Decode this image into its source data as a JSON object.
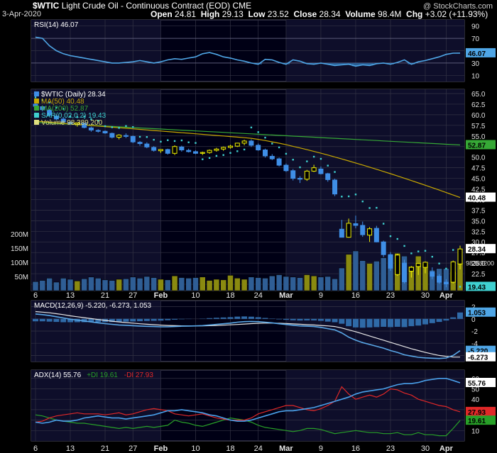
{
  "header": {
    "symbol": "$WTIC",
    "name": "Light Crude Oil - Continuous Contract (EOD)",
    "exchange": "CME",
    "date": "3-Apr-2020",
    "open_label": "Open",
    "open": "24.81",
    "high_label": "High",
    "high": "29.13",
    "low_label": "Low",
    "low": "23.52",
    "close_label": "Close",
    "close": "28.34",
    "volume_label": "Volume",
    "volume": "98.4M",
    "chg_label": "Chg",
    "chg": "+3.02 (+11.93%)",
    "copyright": "@ StockCharts.com"
  },
  "colors": {
    "background": "#000000",
    "panel_bg": "#000015",
    "grid": "#333344",
    "up": "#eeee00",
    "down": "#3f8ee6",
    "rsi": "#4fa6e6",
    "ma50": "#c8a800",
    "ma200": "#36a836",
    "sar": "#3fd0d0",
    "volume_up": "#8a8a10",
    "volume_down": "#2f5e95",
    "macd": "#5aa8e8",
    "signal": "#e8e8e8",
    "adx": "#4aa0ea",
    "plus_di": "#28a028",
    "minus_di": "#e02828"
  },
  "x_ticks": [
    "6",
    "13",
    "21",
    "27",
    "Feb",
    "10",
    "18",
    "24",
    "Mar",
    "9",
    "16",
    "23",
    "30",
    "Apr"
  ],
  "chart_data": [
    {
      "type": "line",
      "panel": "RSI",
      "legend": "RSI(14) 46.07",
      "yticks": [
        "90",
        "70",
        "50",
        "30",
        "10"
      ],
      "ylim": [
        0,
        100
      ],
      "last_label": "46.07",
      "series": [
        {
          "name": "RSI(14)",
          "values": [
            72,
            70,
            58,
            50,
            45,
            42,
            40,
            38,
            36,
            34,
            32,
            30,
            30,
            31,
            32,
            34,
            32,
            30,
            32,
            35,
            37,
            36,
            38,
            40,
            45,
            47,
            44,
            40,
            38,
            35,
            33,
            30,
            28,
            36,
            35,
            31,
            28,
            35,
            33,
            29,
            28,
            30,
            28,
            26,
            27,
            28,
            25,
            27,
            26,
            29,
            30,
            28,
            31,
            35,
            28,
            32,
            34,
            37,
            40,
            44,
            46,
            46.07
          ]
        }
      ]
    },
    {
      "type": "candlestick",
      "panel": "price",
      "legend": [
        "$WTIC (Daily) 28.34",
        "MA(50) 40.48",
        "MA(200) 52.87",
        "SAR(0.02,0.2) 19.43",
        "Volume 98,389,200"
      ],
      "yticks": [
        "65.0",
        "62.5",
        "60.0",
        "57.5",
        "55.0",
        "52.5",
        "50.0",
        "47.5",
        "45.0",
        "42.5",
        "40.0",
        "37.5",
        "35.0",
        "32.5",
        "30.0",
        "27.5",
        "25.0",
        "22.5",
        "20.0"
      ],
      "ylim": [
        18.5,
        66
      ],
      "volume_ticks": [
        "200M",
        "150M",
        "100M",
        "50M"
      ],
      "volume_last_label": "98389200",
      "last_labels": {
        "close": "28.34",
        "ma200": "52.87",
        "ma50": "40.48",
        "sar": "19.43"
      },
      "ohlc": [
        [
          62.5,
          63.1,
          61.8,
          62.0
        ],
        [
          61.9,
          62.2,
          60.8,
          61.2
        ],
        [
          61.1,
          61.4,
          59.6,
          59.9
        ],
        [
          59.7,
          59.9,
          58.7,
          59.0
        ],
        [
          59.0,
          59.4,
          58.0,
          58.3
        ],
        [
          58.2,
          58.6,
          57.6,
          57.9
        ],
        [
          57.8,
          58.2,
          57.2,
          58.1
        ],
        [
          58.0,
          58.1,
          56.8,
          57.0
        ],
        [
          56.9,
          57.2,
          56.0,
          56.4
        ],
        [
          56.3,
          56.6,
          55.8,
          56.1
        ],
        [
          56.1,
          56.3,
          55.5,
          55.7
        ],
        [
          55.6,
          55.8,
          54.4,
          54.7
        ],
        [
          54.7,
          55.4,
          54.2,
          55.2
        ],
        [
          55.1,
          55.6,
          54.5,
          55.0
        ],
        [
          54.9,
          55.1,
          53.3,
          53.6
        ],
        [
          53.5,
          53.8,
          52.7,
          53.2
        ],
        [
          53.1,
          53.5,
          52.1,
          52.4
        ],
        [
          52.3,
          52.6,
          51.3,
          51.6
        ],
        [
          51.5,
          51.9,
          51.0,
          51.8
        ],
        [
          51.8,
          52.0,
          50.6,
          50.9
        ],
        [
          50.9,
          52.8,
          50.5,
          52.5
        ],
        [
          52.4,
          52.7,
          51.3,
          51.7
        ],
        [
          51.6,
          52.0,
          51.1,
          51.3
        ],
        [
          51.3,
          51.6,
          50.7,
          50.9
        ],
        [
          50.9,
          51.3,
          50.5,
          51.1
        ],
        [
          51.1,
          51.8,
          50.8,
          51.6
        ],
        [
          51.6,
          52.2,
          51.3,
          51.9
        ],
        [
          51.9,
          52.5,
          51.5,
          52.3
        ],
        [
          52.3,
          52.9,
          52.0,
          52.6
        ],
        [
          52.6,
          53.4,
          52.4,
          53.3
        ],
        [
          53.3,
          54.1,
          52.8,
          53.8
        ],
        [
          53.8,
          54.2,
          52.4,
          52.8
        ],
        [
          52.8,
          53.2,
          51.5,
          51.7
        ],
        [
          51.7,
          52.0,
          49.9,
          50.3
        ],
        [
          50.2,
          50.7,
          49.3,
          49.6
        ],
        [
          49.6,
          49.9,
          47.8,
          48.1
        ],
        [
          48.1,
          48.5,
          46.5,
          46.8
        ],
        [
          46.8,
          47.2,
          44.5,
          45.0
        ],
        [
          45.0,
          45.5,
          43.9,
          44.8
        ],
        [
          44.8,
          47.0,
          44.4,
          46.7
        ],
        [
          46.7,
          48.2,
          46.5,
          47.5
        ],
        [
          47.2,
          47.8,
          45.9,
          46.1
        ],
        [
          46.1,
          46.3,
          44.2,
          44.7
        ],
        [
          44.6,
          44.9,
          40.8,
          41.3
        ],
        [
          33.0,
          35.2,
          31.5,
          31.1
        ],
        [
          31.1,
          35.5,
          31.0,
          34.4
        ],
        [
          34.3,
          36.2,
          33.2,
          33.9
        ],
        [
          33.9,
          34.8,
          31.2,
          31.7
        ],
        [
          31.6,
          33.5,
          30.0,
          33.1
        ],
        [
          33.2,
          33.8,
          29.9,
          30.0
        ],
        [
          30.0,
          30.3,
          26.4,
          27.0
        ],
        [
          27.0,
          27.6,
          23.2,
          23.8
        ],
        [
          22.3,
          27.2,
          22.0,
          26.9
        ],
        [
          25.0,
          25.8,
          20.2,
          20.6
        ],
        [
          23.1,
          24.3,
          21.6,
          24.0
        ],
        [
          24.2,
          25.0,
          22.2,
          24.9
        ],
        [
          24.0,
          25.4,
          22.6,
          25.2
        ],
        [
          22.9,
          24.0,
          21.2,
          21.9
        ],
        [
          21.9,
          22.4,
          20.1,
          20.5
        ],
        [
          20.5,
          21.2,
          19.3,
          20.1
        ],
        [
          20.5,
          25.6,
          20.2,
          25.3
        ],
        [
          24.81,
          29.13,
          23.52,
          28.34
        ]
      ],
      "volume_m": [
        32,
        36,
        44,
        30,
        44,
        40,
        34,
        42,
        48,
        44,
        38,
        36,
        40,
        42,
        48,
        44,
        50,
        46,
        40,
        38,
        52,
        46,
        44,
        46,
        48,
        36,
        40,
        38,
        54,
        44,
        40,
        48,
        46,
        44,
        52,
        56,
        50,
        48,
        46,
        56,
        52,
        48,
        50,
        42,
        80,
        128,
        140,
        106,
        96,
        104,
        116,
        126,
        132,
        122,
        86,
        122,
        96,
        72,
        78,
        78,
        68,
        98.4
      ]
    },
    {
      "type": "line",
      "panel": "MACD",
      "legend": "MACD(12,26,9) -5.220, -6.273, 1.053",
      "yticks": [
        "2",
        "0",
        "-2",
        "-4",
        "-6"
      ],
      "ylim": [
        -7,
        3
      ],
      "last_labels": {
        "histogram": "1.053",
        "macd": "-5.220",
        "signal": "-6.273"
      },
      "series": [
        {
          "name": "MACD",
          "values": [
            0.8,
            0.7,
            0.55,
            0.35,
            0.15,
            -0.05,
            -0.2,
            -0.35,
            -0.5,
            -0.65,
            -0.78,
            -0.9,
            -1.0,
            -1.05,
            -1.12,
            -1.18,
            -1.22,
            -1.26,
            -1.3,
            -1.3,
            -1.25,
            -1.2,
            -1.18,
            -1.15,
            -1.1,
            -1.0,
            -0.9,
            -0.8,
            -0.7,
            -0.55,
            -0.45,
            -0.42,
            -0.45,
            -0.55,
            -0.65,
            -0.8,
            -0.92,
            -1.05,
            -1.15,
            -1.2,
            -1.25,
            -1.4,
            -1.6,
            -1.8,
            -2.3,
            -3.0,
            -3.5,
            -3.9,
            -4.2,
            -4.5,
            -4.8,
            -5.2,
            -5.5,
            -5.9,
            -6.1,
            -6.3,
            -6.4,
            -6.45,
            -6.5,
            -6.42,
            -6.0,
            -5.22
          ]
        },
        {
          "name": "Signal",
          "values": [
            1.2,
            1.1,
            1.0,
            0.85,
            0.7,
            0.5,
            0.35,
            0.2,
            0.05,
            -0.1,
            -0.25,
            -0.38,
            -0.5,
            -0.6,
            -0.7,
            -0.8,
            -0.88,
            -0.95,
            -1.02,
            -1.08,
            -1.12,
            -1.14,
            -1.15,
            -1.15,
            -1.14,
            -1.12,
            -1.08,
            -1.03,
            -0.98,
            -0.92,
            -0.85,
            -0.78,
            -0.72,
            -0.7,
            -0.7,
            -0.72,
            -0.76,
            -0.82,
            -0.88,
            -0.95,
            -1.0,
            -1.08,
            -1.15,
            -1.25,
            -1.5,
            -1.8,
            -2.1,
            -2.45,
            -2.8,
            -3.15,
            -3.5,
            -3.85,
            -4.2,
            -4.55,
            -4.9,
            -5.2,
            -5.5,
            -5.75,
            -6.0,
            -6.15,
            -6.25,
            -6.27
          ]
        },
        {
          "name": "Histogram",
          "values": [
            -0.4,
            -0.4,
            -0.45,
            -0.5,
            -0.55,
            -0.55,
            -0.55,
            -0.55,
            -0.55,
            -0.55,
            -0.53,
            -0.52,
            -0.5,
            -0.45,
            -0.42,
            -0.38,
            -0.34,
            -0.31,
            -0.28,
            -0.22,
            -0.13,
            -0.06,
            -0.03,
            0,
            0.04,
            0.12,
            0.18,
            0.23,
            0.28,
            0.37,
            0.4,
            0.36,
            0.27,
            0.15,
            0.05,
            -0.08,
            -0.16,
            -0.23,
            -0.27,
            -0.25,
            -0.25,
            -0.32,
            -0.45,
            -0.55,
            -0.8,
            -1.2,
            -1.4,
            -1.45,
            -1.4,
            -1.35,
            -1.3,
            -1.35,
            -1.3,
            -1.35,
            -1.2,
            -1.1,
            -0.9,
            -0.7,
            -0.5,
            -0.27,
            0.25,
            1.05
          ]
        }
      ]
    },
    {
      "type": "line",
      "panel": "ADX",
      "legend": "ADX(14) 55.76 +DI 19.61 -DI 27.93",
      "yticks": [
        "60",
        "50",
        "40",
        "30",
        "20",
        "10"
      ],
      "ylim": [
        0,
        68
      ],
      "last_labels": {
        "adx": "55.76",
        "minus_di": "27.93",
        "plus_di": "19.61"
      },
      "series": [
        {
          "name": "ADX(14)",
          "values": [
            18,
            17,
            18,
            20,
            19,
            19,
            20,
            22,
            23,
            24,
            23,
            22,
            22,
            21,
            22,
            23,
            24,
            25,
            27,
            29,
            29,
            30,
            29,
            28,
            27,
            25,
            24,
            22,
            20,
            19,
            19,
            20,
            22,
            24,
            26,
            28,
            29,
            29,
            30,
            31,
            32,
            34,
            36,
            38,
            40,
            42,
            45,
            47,
            48,
            49,
            50,
            52,
            54,
            55,
            55,
            56,
            58,
            59,
            60,
            60,
            58,
            55.76
          ]
        },
        {
          "name": "+DI",
          "values": [
            25,
            24,
            22,
            20,
            19,
            18,
            17,
            17,
            16,
            15,
            14,
            13,
            12,
            13,
            12,
            13,
            14,
            13,
            14,
            15,
            20,
            18,
            17,
            15,
            14,
            16,
            18,
            20,
            22,
            21,
            20,
            18,
            15,
            13,
            12,
            11,
            10,
            9,
            10,
            12,
            12,
            11,
            9,
            7,
            8,
            9,
            10,
            9,
            8,
            8,
            7,
            7,
            8,
            6,
            6,
            8,
            6,
            6,
            5,
            5,
            12,
            19.61
          ]
        },
        {
          "name": "-DI",
          "values": [
            18,
            19,
            22,
            24,
            25,
            26,
            27,
            26,
            26,
            26,
            25,
            26,
            27,
            25,
            26,
            28,
            30,
            31,
            30,
            29,
            26,
            25,
            24,
            25,
            26,
            24,
            22,
            21,
            20,
            20,
            20,
            22,
            26,
            28,
            30,
            32,
            34,
            34,
            32,
            30,
            29,
            31,
            34,
            38,
            52,
            45,
            40,
            42,
            44,
            42,
            45,
            50,
            49,
            46,
            44,
            40,
            38,
            36,
            34,
            33,
            30,
            27.93
          ]
        }
      ]
    }
  ]
}
